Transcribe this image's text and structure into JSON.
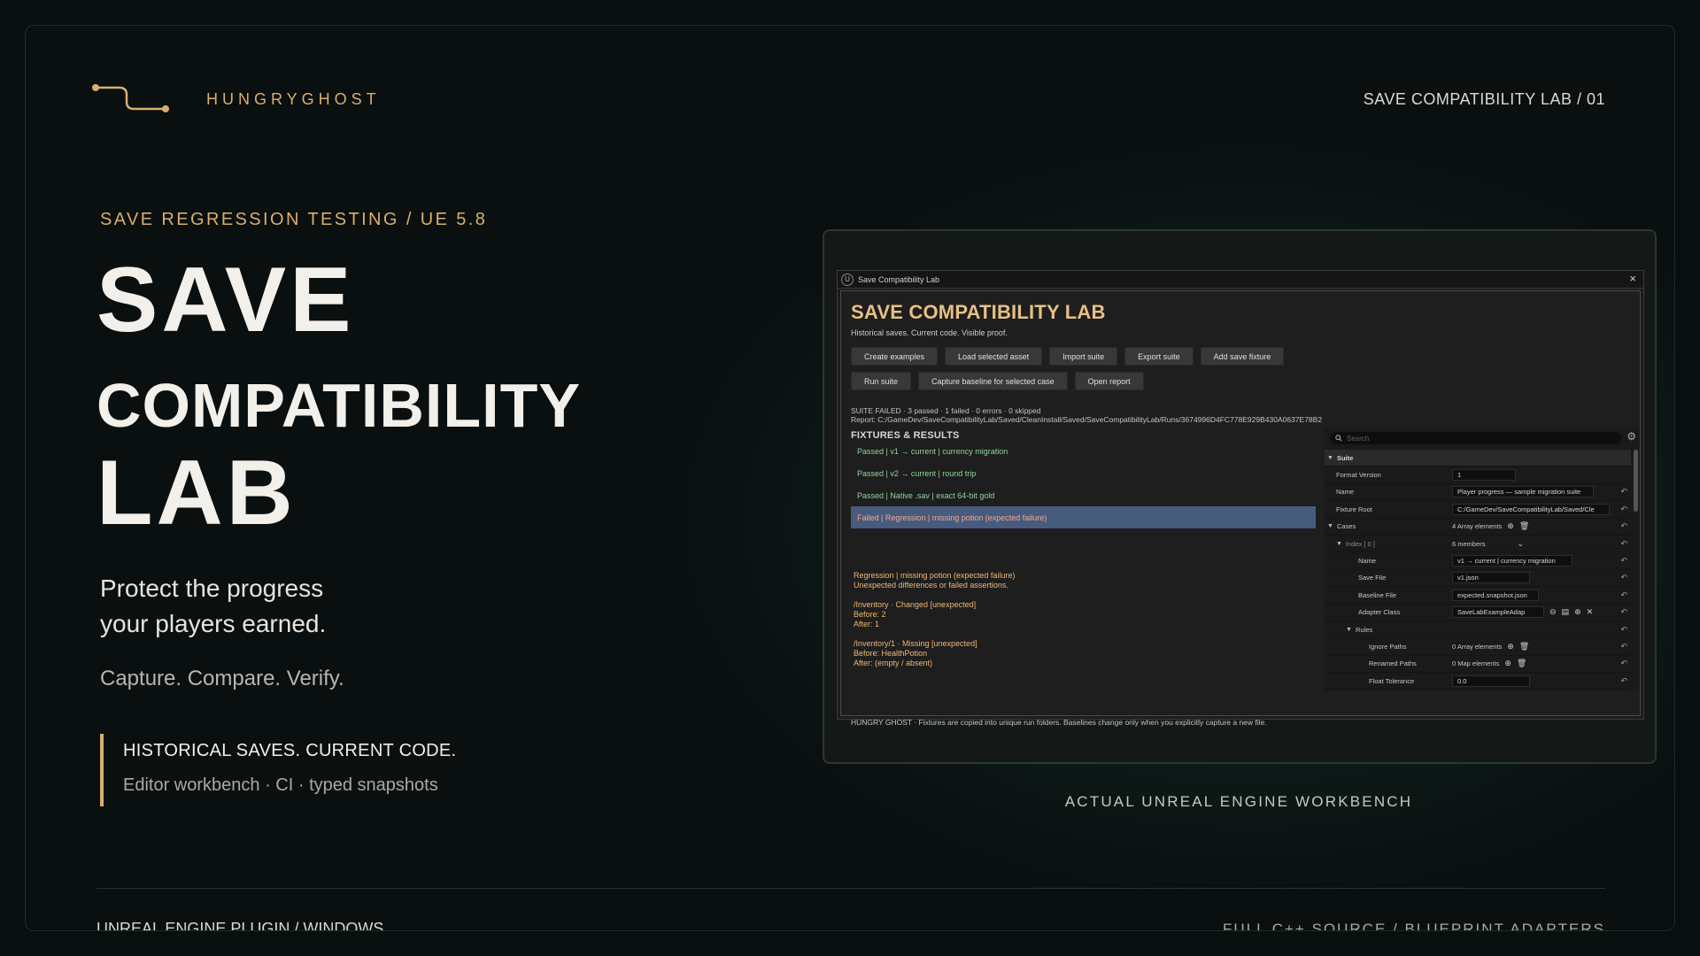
{
  "brand": {
    "name": "HUNGRYGHOST",
    "slide_id": "SAVE COMPATIBILITY LAB / 01",
    "accent": "#d9ae6e"
  },
  "hero": {
    "eyebrow": "SAVE REGRESSION TESTING / UE 5.8",
    "title_1": "SAVE",
    "title_2": "COMPATIBILITY",
    "title_3": "LAB",
    "tagline_1": "Protect the progress",
    "tagline_2": "your players earned.",
    "motto": "Capture. Compare. Verify.",
    "callout_title": "HISTORICAL SAVES. CURRENT CODE.",
    "callout_sub": "Editor workbench · CI · typed snapshots"
  },
  "footer": {
    "left": "UNREAL ENGINE PLUGIN / WINDOWS",
    "right": "FULL C++ SOURCE / BLUEPRINT ADAPTERS"
  },
  "caption": "ACTUAL UNREAL ENGINE WORKBENCH",
  "window": {
    "title": "Save Compatibility Lab",
    "heading": "SAVE COMPATIBILITY LAB",
    "subtitle": "Historical saves. Current code. Visible proof.",
    "buttons_row1": [
      "Create examples",
      "Load selected asset",
      "Import suite",
      "Export suite",
      "Add save fixture"
    ],
    "buttons_row2": [
      "Run suite",
      "Capture baseline for selected case",
      "Open report"
    ],
    "status": "SUITE FAILED  ·  3 passed  ·  1 failed  ·  0 errors  ·  0 skipped",
    "report": "Report: C:/GameDev/SaveCompatibilityLab/Saved/CleanInstall/Saved/SaveCompatibilityLab/Runs/3674996D4FC778E929B430A0637E78B2",
    "section": "FIXTURES & RESULTS",
    "fixtures": [
      "Passed  |  v1 → current | currency migration",
      "Passed  |  v2 → current | round trip",
      "Passed  |  Native .sav | exact 64-bit gold",
      "Failed  |  Regression | missing potion (expected failure)"
    ],
    "detail": {
      "l1": "Regression | missing potion (expected failure)",
      "l2": "Unexpected differences or failed assertions.",
      "l3": "/Inventory  ·  Changed  [unexpected]",
      "l4": "Before: 2",
      "l5": "After: 1",
      "l6": "/Inventory/1  ·  Missing  [unexpected]",
      "l7": "Before: HealthPotion",
      "l8": "After: (empty / absent)"
    },
    "footer_note": "HUNGRY GHOST  ·  Fixtures are copied into unique run folders. Baselines change only when you explicitly capture a new file.",
    "details_panel": {
      "search_placeholder": "Search",
      "suite": "Suite",
      "format_version_label": "Format Version",
      "format_version": "1",
      "name_label": "Name",
      "name": "Player progress — sample migration suite",
      "fixture_root_label": "Fixture Root",
      "fixture_root": "C:/GameDev/SaveCompatibilityLab/Saved/Cle",
      "cases_label": "Cases",
      "cases_value": "4 Array elements",
      "index_label": "Index [ 0 ]",
      "index_value": "6 members",
      "case_name_label": "Name",
      "case_name": "v1 → current | currency migration",
      "save_file_label": "Save File",
      "save_file": "v1.json",
      "baseline_label": "Baseline File",
      "baseline": "expected.snapshot.json",
      "adapter_label": "Adapter Class",
      "adapter": "SaveLabExampleAdap",
      "rules_label": "Rules",
      "ignore_label": "Ignore Paths",
      "ignore_value": "0 Array elements",
      "renamed_label": "Renamed Paths",
      "renamed_value": "0 Map elements",
      "float_label": "Float Tolerance",
      "float_value": "0.0"
    }
  }
}
